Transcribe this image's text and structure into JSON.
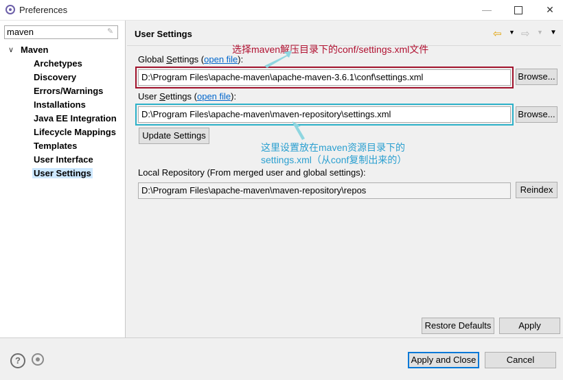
{
  "window": {
    "title": "Preferences",
    "minimize": "—",
    "close": "✕"
  },
  "sidebar": {
    "filter_value": "maven",
    "items": [
      {
        "label": "Maven"
      },
      {
        "label": "Archetypes"
      },
      {
        "label": "Discovery"
      },
      {
        "label": "Errors/Warnings"
      },
      {
        "label": "Installations"
      },
      {
        "label": "Java EE Integration"
      },
      {
        "label": "Lifecycle Mappings"
      },
      {
        "label": "Templates"
      },
      {
        "label": "User Interface"
      },
      {
        "label": "User Settings"
      }
    ]
  },
  "page": {
    "title": "User Settings",
    "global_label_prefix": "Global ",
    "global_label_mnemonic": "S",
    "global_label_rest": "ettings (",
    "global_label_suffix": "):",
    "open_file": "open file",
    "global_path": "D:\\Program Files\\apache-maven\\apache-maven-3.6.1\\conf\\settings.xml",
    "user_label_prefix": "User ",
    "user_label_mnemonic": "S",
    "user_label_rest": "ettings (",
    "user_label_suffix": "):",
    "user_path": "D:\\Program Files\\apache-maven\\maven-repository\\settings.xml",
    "browse": "Browse...",
    "update_settings": "Update Settings",
    "local_repo_label": "Local Repository (From merged user and global settings):",
    "local_repo_path": "D:\\Program Files\\apache-maven\\maven-repository\\repos",
    "reindex": "Reindex",
    "restore_defaults": "Restore Defaults",
    "apply": "Apply"
  },
  "annotations": {
    "red": "选择maven解压目录下的conf/settings.xml文件",
    "blue_line1": "这里设置放在maven资源目录下的",
    "blue_line2": "settings.xml（从conf复制出来的）"
  },
  "footer": {
    "apply_and_close": "Apply and Close",
    "cancel": "Cancel",
    "help": "?"
  },
  "colors": {
    "red_highlight": "#a0102a",
    "cyan_highlight": "#2ab0c8",
    "selection": "#cde8ff",
    "link": "#0066cc"
  }
}
